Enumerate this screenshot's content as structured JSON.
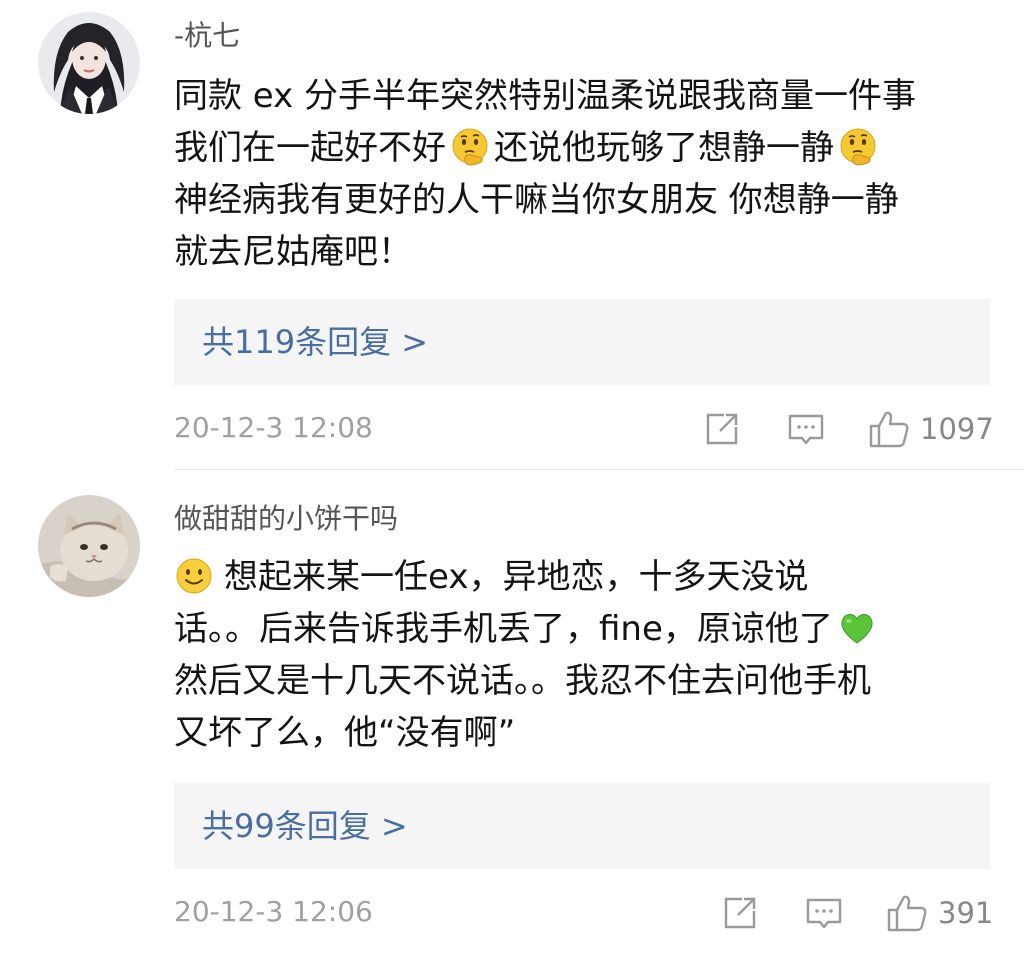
{
  "comments": [
    {
      "username": "-杭七",
      "avatar_icon": "avatar-girl-portrait",
      "lines": [
        {
          "text": "同款 ex 分手半年突然特别温柔说跟我商量一件事"
        },
        {
          "before": "我们在一起好不好",
          "emoji": "thinking-face-emoji",
          "after": "还说他玩够了想静一静",
          "trailing_emoji": "thinking-face-emoji"
        },
        {
          "text": "神经病我有更好的人干嘛当你女朋友 你想静一静"
        },
        {
          "text": "就去尼姑庵吧！"
        }
      ],
      "replies_label": "共119条回复 >",
      "timestamp": "20-12-3 12:08",
      "like_count": "1097"
    },
    {
      "username": "做甜甜的小饼干吗",
      "avatar_icon": "avatar-cat-photo",
      "lines": [
        {
          "lead_emoji": "smiling-face-emoji",
          "text": "想起来某一任ex，异地恋，十多天没说"
        },
        {
          "before": "话。。后来告诉我手机丢了，fine，原谅他了",
          "emoji": "green-heart-emoji"
        },
        {
          "text": "然后又是十几天不说话。。我忍不住去问他手机"
        },
        {
          "text": "又坏了么，他“没有啊”"
        }
      ],
      "replies_label": "共99条回复 >",
      "timestamp": "20-12-3 12:06",
      "like_count": "391"
    }
  ],
  "icons": {
    "share": "share-icon",
    "comment": "comment-icon",
    "like": "thumbs-up-icon"
  },
  "colors": {
    "reply_link": "#4a6ea0",
    "reply_box_bg": "#f5f5f5",
    "meta_text": "#a0a0a0",
    "username": "#555555"
  }
}
